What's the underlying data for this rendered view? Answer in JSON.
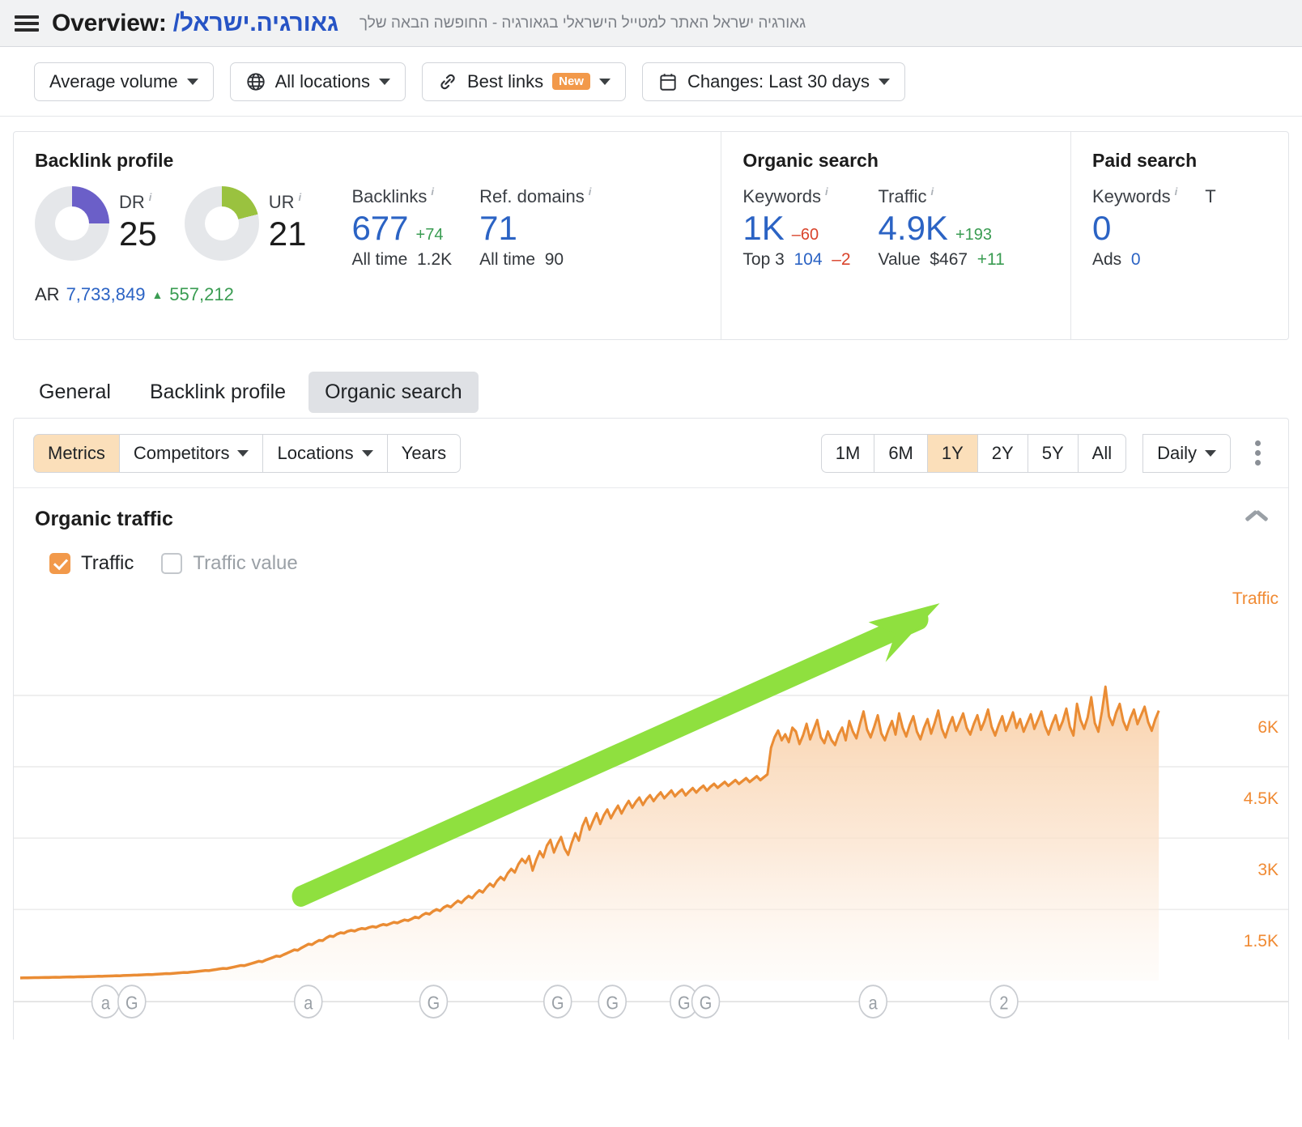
{
  "header": {
    "menu_icon": "hamburger-icon",
    "title_prefix": "Overview:",
    "domain": "/גאורגיה.ישראל",
    "tagline": "גאורגיה ישראל האתר למטייל הישראלי בגאורגיה - החופשה הבאה שלך"
  },
  "filters": [
    {
      "label": "Average volume",
      "icon": "",
      "caret": true,
      "badge": ""
    },
    {
      "label": "All locations",
      "icon": "globe-icon",
      "caret": true,
      "badge": ""
    },
    {
      "label": "Best links",
      "icon": "link-icon",
      "caret": true,
      "badge": "New"
    },
    {
      "label": "Changes: Last 30 days",
      "icon": "calendar-icon",
      "caret": true,
      "badge": ""
    }
  ],
  "overview": {
    "backlink_profile": {
      "title": "Backlink profile",
      "dr": {
        "label": "DR",
        "value": "25",
        "percent": 25,
        "color": "#6b5fc8"
      },
      "ur": {
        "label": "UR",
        "value": "21",
        "percent": 21,
        "color": "#9ac23f"
      },
      "backlinks": {
        "label": "Backlinks",
        "value": "677",
        "delta": "+74",
        "sub_label": "All time",
        "sub_value": "1.2K"
      },
      "ref_domains": {
        "label": "Ref. domains",
        "value": "71",
        "delta": "",
        "sub_label": "All time",
        "sub_value": "90"
      },
      "ar": {
        "label": "AR",
        "value": "7,733,849",
        "arrow": "▲",
        "change": "557,212"
      }
    },
    "organic_search": {
      "title": "Organic search",
      "keywords": {
        "label": "Keywords",
        "value": "1K",
        "delta": "–60",
        "sub_label": "Top 3",
        "sub_value": "104",
        "sub_delta": "–2"
      },
      "traffic": {
        "label": "Traffic",
        "value": "4.9K",
        "delta": "+193",
        "sub_label": "Value",
        "sub_value": "$467",
        "sub_delta": "+11"
      }
    },
    "paid_search": {
      "title": "Paid search",
      "keywords": {
        "label": "Keywords",
        "value": "0",
        "sub_label": "Ads",
        "sub_value": "0"
      },
      "traffic_clipped": "T"
    }
  },
  "tabs": [
    {
      "label": "General",
      "active": false
    },
    {
      "label": "Backlink profile",
      "active": false
    },
    {
      "label": "Organic search",
      "active": true
    }
  ],
  "panel_toolbar": {
    "left_segments": [
      {
        "label": "Metrics",
        "caret": false,
        "active": true
      },
      {
        "label": "Competitors",
        "caret": true,
        "active": false
      },
      {
        "label": "Locations",
        "caret": true,
        "active": false
      },
      {
        "label": "Years",
        "caret": false,
        "active": false
      }
    ],
    "ranges": [
      {
        "label": "1M",
        "active": false
      },
      {
        "label": "6M",
        "active": false
      },
      {
        "label": "1Y",
        "active": true
      },
      {
        "label": "2Y",
        "active": false
      },
      {
        "label": "5Y",
        "active": false
      },
      {
        "label": "All",
        "active": false
      }
    ],
    "granularity": {
      "label": "Daily",
      "caret": true
    },
    "kebab_icon": "more-vertical-icon"
  },
  "chart_section": {
    "title": "Organic traffic",
    "collapse_icon": "chevron-up-icon",
    "legend": [
      {
        "label": "Traffic",
        "checked": true
      },
      {
        "label": "Traffic value",
        "checked": false
      }
    ]
  },
  "chart_data": {
    "type": "area",
    "title": "Organic traffic",
    "series_name": "Traffic",
    "axis_title": "Traffic",
    "xlabel": "",
    "ylabel": "Traffic",
    "ylim": [
      0,
      7500
    ],
    "yticks": [
      6000,
      4500,
      3000,
      1500
    ],
    "ytick_labels": [
      "6K",
      "4.5K",
      "3K",
      "1.5K"
    ],
    "grid": true,
    "line_color": "#ea8c34",
    "fill_color": "#fbe0c8",
    "legend_position": "top-left",
    "values": [
      60,
      62,
      61,
      64,
      66,
      65,
      68,
      70,
      69,
      72,
      74,
      73,
      76,
      78,
      80,
      79,
      82,
      85,
      84,
      88,
      90,
      92,
      95,
      94,
      98,
      100,
      103,
      106,
      105,
      110,
      112,
      115,
      118,
      120,
      124,
      128,
      132,
      130,
      136,
      140,
      145,
      150,
      148,
      156,
      162,
      168,
      175,
      172,
      182,
      190,
      198,
      206,
      215,
      212,
      225,
      236,
      248,
      260,
      255,
      272,
      288,
      305,
      322,
      318,
      340,
      362,
      385,
      410,
      400,
      435,
      462,
      490,
      520,
      510,
      548,
      580,
      615,
      650,
      640,
      690,
      730,
      770,
      760,
      810,
      850,
      845,
      900,
      940,
      930,
      980,
      1010,
      1000,
      1040,
      1060,
      1045,
      1080,
      1100,
      1090,
      1120,
      1140,
      1125,
      1160,
      1185,
      1170,
      1200,
      1230,
      1215,
      1250,
      1280,
      1265,
      1300,
      1340,
      1320,
      1380,
      1420,
      1400,
      1460,
      1500,
      1470,
      1540,
      1580,
      1550,
      1620,
      1680,
      1640,
      1720,
      1780,
      1740,
      1830,
      1900,
      1860,
      1960,
      2040,
      1980,
      2100,
      2180,
      2120,
      2260,
      2350,
      2280,
      2450,
      2560,
      2480,
      2620,
      2320,
      2540,
      2720,
      2600,
      2840,
      2960,
      2700,
      2880,
      3020,
      2780,
      2650,
      2900,
      3100,
      2950,
      3250,
      3420,
      3180,
      3360,
      3520,
      3300,
      3480,
      3600,
      3420,
      3560,
      3680,
      3520,
      3660,
      3780,
      3640,
      3760,
      3850,
      3700,
      3820,
      3900,
      3780,
      3880,
      3960,
      3840,
      3920,
      4000,
      3880,
      3960,
      4020,
      3900,
      3980,
      4050,
      3960,
      4040,
      4100,
      4000,
      4080,
      4140,
      4060,
      4120,
      4180,
      4100,
      4160,
      4220,
      4140,
      4200,
      4260,
      4180,
      4240,
      4300,
      4220,
      4280,
      4340,
      4900,
      5120,
      5260,
      5060,
      5180,
      5020,
      5320,
      5240,
      4980,
      5160,
      5400,
      5080,
      5280,
      5480,
      5120,
      5000,
      5240,
      5060,
      4960,
      5180,
      5320,
      5060,
      5460,
      5240,
      5100,
      5400,
      5660,
      5280,
      5120,
      5340,
      5580,
      5200,
      5060,
      5280,
      5460,
      5180,
      5620,
      5320,
      5140,
      5380,
      5560,
      5240,
      5080,
      5320,
      5500,
      5200,
      5420,
      5680,
      5300,
      5120,
      5360,
      5540,
      5260,
      5440,
      5620,
      5320,
      5180,
      5400,
      5580,
      5280,
      5460,
      5700,
      5340,
      5160,
      5380,
      5560,
      5260,
      5440,
      5640,
      5320,
      5500,
      5240,
      5420,
      5600,
      5300,
      5480,
      5660,
      5360,
      5180,
      5400,
      5580,
      5280,
      5460,
      5720,
      5340,
      5160,
      5820,
      5480,
      5300,
      5540,
      5960,
      5420,
      5240,
      5660,
      6180,
      5560,
      5380,
      5640,
      5820,
      5460,
      5280,
      5520,
      5700,
      5400,
      5580,
      5760,
      5440,
      5260,
      5500,
      5680
    ],
    "annotation": {
      "type": "arrow",
      "color": "#8fe03f",
      "direction": "up-right",
      "description": "Hand-drawn upward growth arrow overlay"
    },
    "event_markers": [
      {
        "glyph": "a",
        "x_ratio": 0.075
      },
      {
        "glyph": "G",
        "x_ratio": 0.098
      },
      {
        "glyph": "a",
        "x_ratio": 0.253
      },
      {
        "glyph": "G",
        "x_ratio": 0.363
      },
      {
        "glyph": "G",
        "x_ratio": 0.472
      },
      {
        "glyph": "G",
        "x_ratio": 0.52
      },
      {
        "glyph": "G",
        "x_ratio": 0.583
      },
      {
        "glyph": "G",
        "x_ratio": 0.602
      },
      {
        "glyph": "a",
        "x_ratio": 0.749
      },
      {
        "glyph": "2",
        "x_ratio": 0.864
      }
    ]
  }
}
